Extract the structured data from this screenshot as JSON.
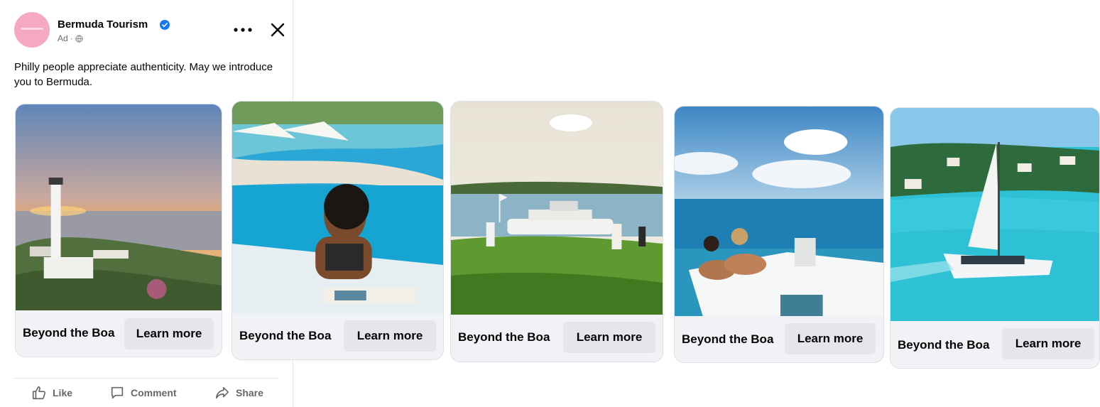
{
  "post": {
    "page_name": "Bermuda Tourism",
    "sponsored_label": "Ad",
    "separator": "·",
    "text": "Philly people appreciate authenticity. May we introduce you to Bermuda.",
    "icons": [
      "verified-badge-icon",
      "globe-icon",
      "more-options-icon",
      "close-icon"
    ]
  },
  "carousel": {
    "cards": [
      {
        "title": "Beyond the Boa",
        "cta": "Learn more",
        "image": "lighthouse-sunset"
      },
      {
        "title": "Beyond the Boa",
        "cta": "Learn more",
        "image": "woman-infinity-pool"
      },
      {
        "title": "Beyond the Boa",
        "cta": "Learn more",
        "image": "golf-course-yacht"
      },
      {
        "title": "Beyond the Boa",
        "cta": "Learn more",
        "image": "couple-on-boat"
      },
      {
        "title": "Beyond the Boa",
        "cta": "Learn more",
        "image": "catamaran-sailing"
      }
    ]
  },
  "actions": {
    "like": "Like",
    "comment": "Comment",
    "share": "Share"
  },
  "colors": {
    "brand_avatar": "#f4a8c4",
    "verified": "#1877f2",
    "button_bg": "#e4e6eb",
    "card_bg": "#f0f2f5",
    "muted_text": "#65676b"
  }
}
